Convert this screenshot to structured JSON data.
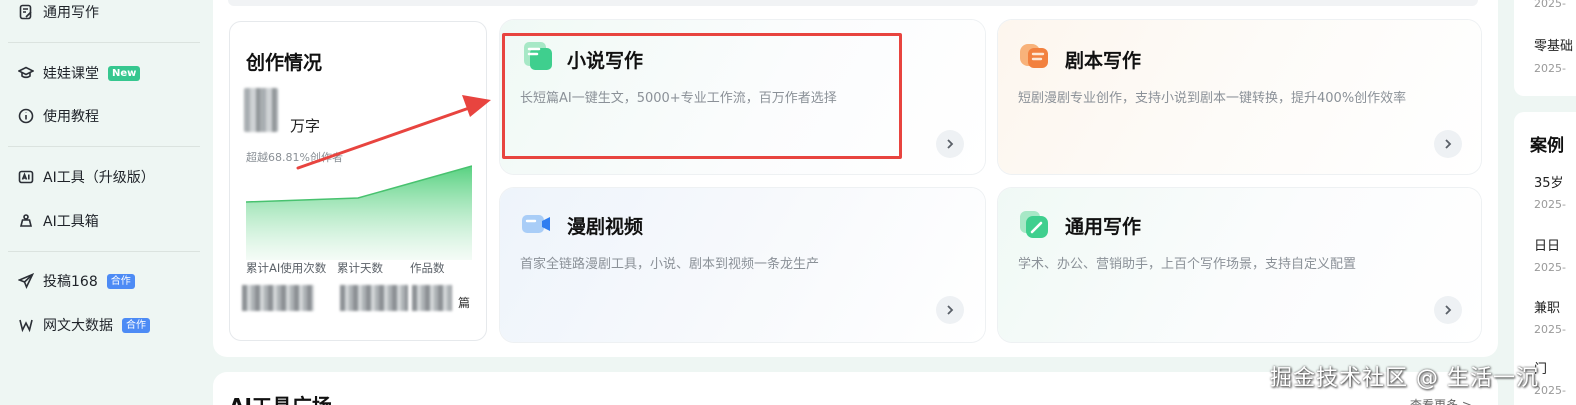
{
  "sidebar": {
    "items": [
      {
        "label": "通用写作",
        "icon": "edit-doc-icon"
      },
      {
        "label": "娃娃课堂",
        "icon": "graduation-cap-icon",
        "badge": "New"
      },
      {
        "label": "使用教程",
        "icon": "info-circle-icon"
      },
      {
        "label": "AI工具（升级版）",
        "icon": "ai-tool-icon"
      },
      {
        "label": "AI工具箱",
        "icon": "toolbox-icon"
      },
      {
        "label": "投稿168",
        "icon": "send-icon",
        "badge": "合作"
      },
      {
        "label": "网文大数据",
        "icon": "data-w-icon",
        "badge": "合作"
      }
    ]
  },
  "stats": {
    "title": "创作情况",
    "unit": "万字",
    "beyond": "超越68.81%创作者",
    "labels": [
      "累计AI使用次数",
      "累计天数",
      "作品数"
    ],
    "works_suffix": "篇"
  },
  "features": [
    {
      "title": "小说写作",
      "desc": "长短篇AI一键生文，5000+专业工作流，百万作者选择",
      "icon": "novel-doc-icon"
    },
    {
      "title": "剧本写作",
      "desc": "短剧漫剧专业创作，支持小说到剧本一键转换，提升400%创作效率",
      "icon": "script-icon"
    },
    {
      "title": "漫剧视频",
      "desc": "首家全链路漫剧工具，小说、剧本到视频一条龙生产",
      "icon": "video-camera-icon"
    },
    {
      "title": "通用写作",
      "desc": "学术、办公、营销助手，上百个写作场景，支持自定义配置",
      "icon": "pen-doc-icon"
    }
  ],
  "section2": {
    "title": "AI工具广场",
    "more": "查看更多 >"
  },
  "right_panel": {
    "top_items": [
      {
        "title": "",
        "date": "2025-"
      },
      {
        "title": "零基础",
        "date": "2025-"
      }
    ],
    "case_title": "案例",
    "cases": [
      {
        "title": "35岁",
        "date": "2025-"
      },
      {
        "title": "日日",
        "date": "2025-"
      },
      {
        "title": "兼职",
        "date": "2025-"
      },
      {
        "title": "门",
        "date": "2025-"
      }
    ]
  },
  "watermark": "掘金技术社区 @ 生活一沉",
  "colors": {
    "accent_green": "#36c78f",
    "highlight_red": "#e8443f",
    "coop_blue": "#4d8bf5"
  }
}
